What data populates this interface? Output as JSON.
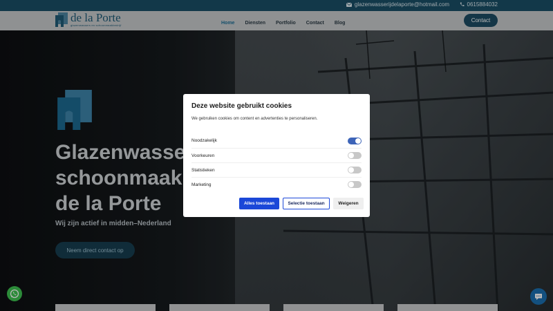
{
  "topbar": {
    "email": "glazenwasserijdelaporte@hotmail.com",
    "phone": "0615884032"
  },
  "header": {
    "logo_name": "de la Porte",
    "logo_tagline": "glazenwassers en schoonmaakbedrijf",
    "nav": [
      "Home",
      "Diensten",
      "Portfolio",
      "Contact",
      "Blog"
    ],
    "active_nav": "Home",
    "contact_button": "Contact"
  },
  "hero": {
    "title": "Glazenwasserij &\nschoonmaakbedrijf\nde la Porte",
    "subtitle": "Wij zijn actief in midden–Nederland",
    "cta": "Neem direct contact op"
  },
  "cookie_modal": {
    "title": "Deze website gebruikt cookies",
    "text": "We gebruiken cookies om content en advertenties te personaliseren.",
    "options": [
      {
        "label": "Noodzakelijk",
        "enabled": true
      },
      {
        "label": "Voorkeuren",
        "enabled": false
      },
      {
        "label": "Statistieken",
        "enabled": false
      },
      {
        "label": "Marketing",
        "enabled": false
      }
    ],
    "buttons": {
      "accept_all": "Alles toestaan",
      "accept_selection": "Selectie toestaan",
      "reject": "Weigeren"
    }
  },
  "colors": {
    "brand": "#1f5a76",
    "header_bg": "#c6c9cb",
    "topbar_bg": "#1a4e66",
    "primary_button": "#1b48d8",
    "toggle_on": "#3d64b8"
  }
}
